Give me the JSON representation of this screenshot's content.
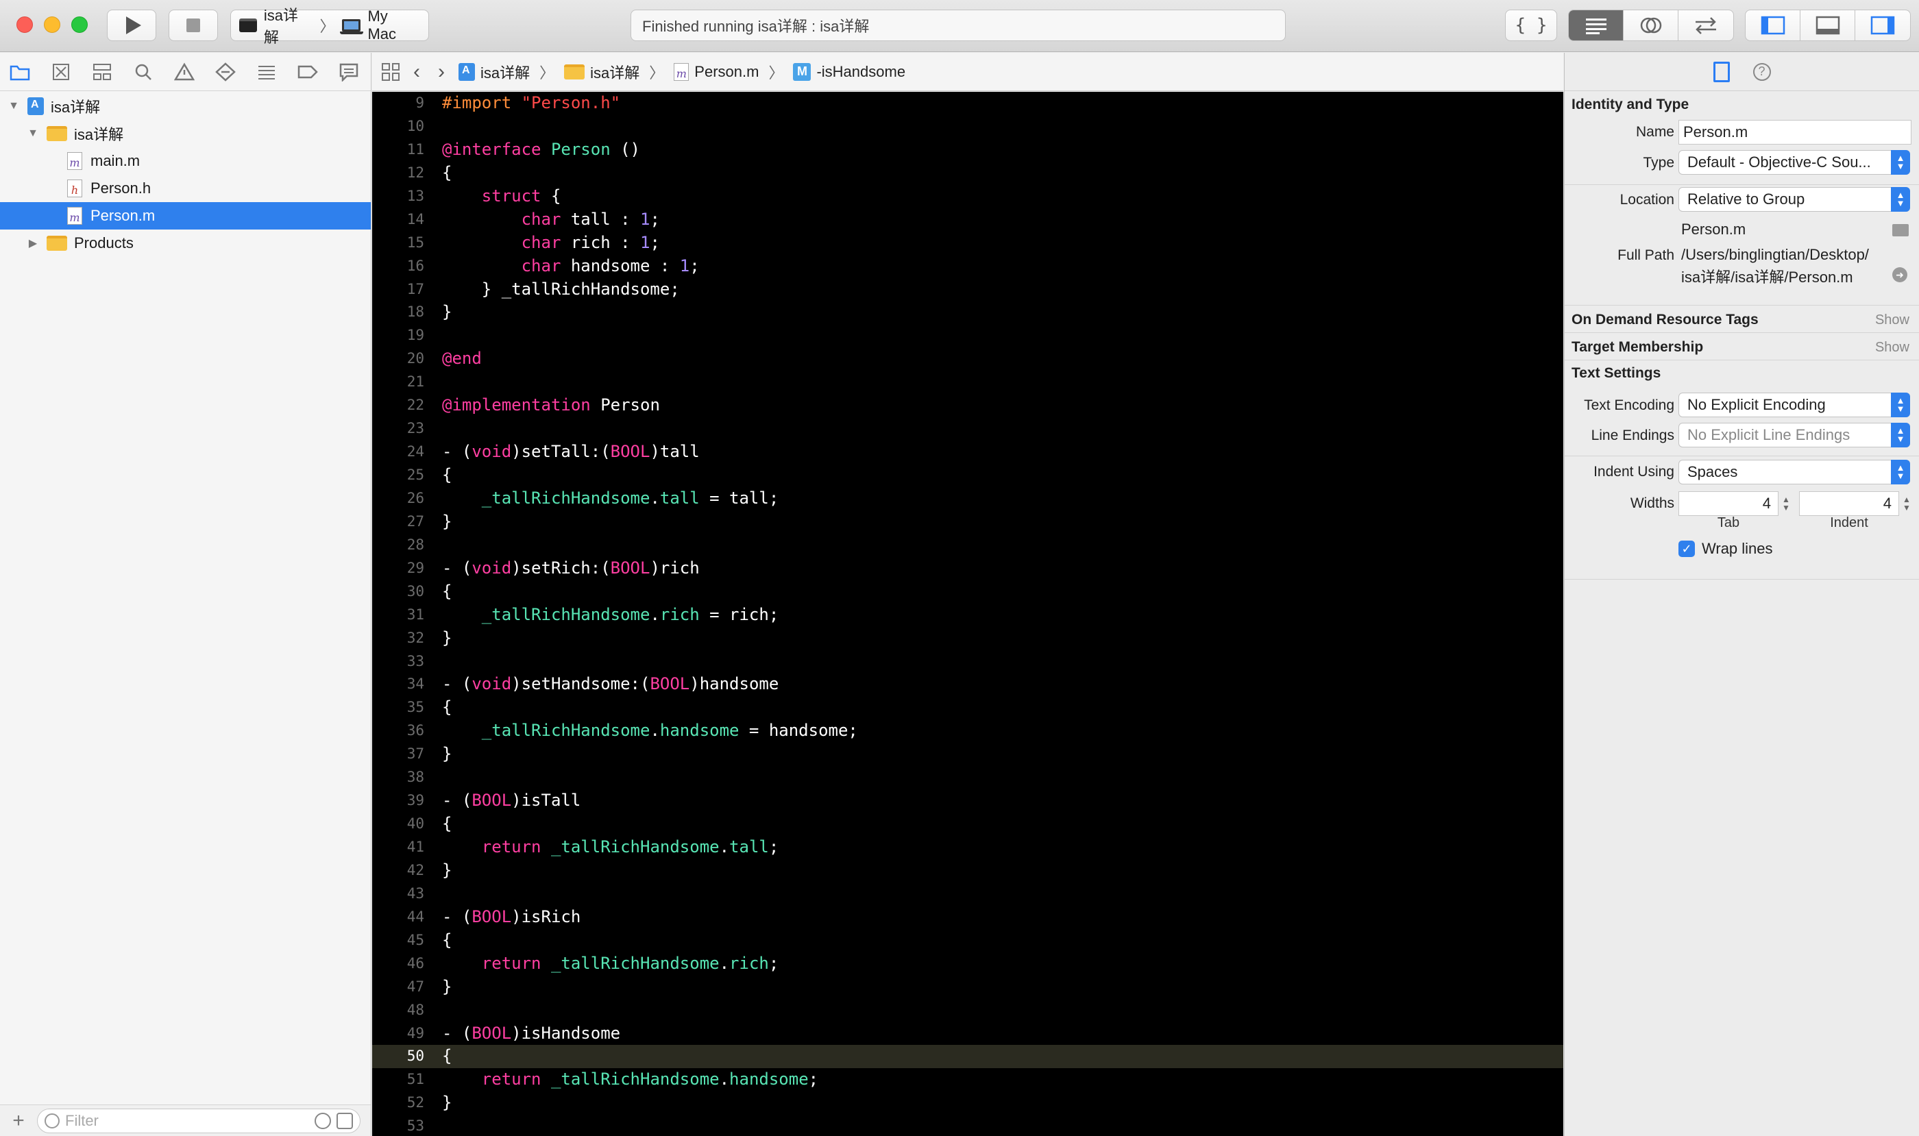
{
  "toolbar": {
    "scheme_name": "isa详解",
    "destination": "My Mac",
    "activity_status": "Finished running isa详解 : isa详解",
    "code_snippet_icon": "braces-icon",
    "editor_modes": [
      "standard-editor-icon",
      "assistant-editor-icon",
      "version-editor-icon"
    ],
    "view_toggles": [
      "navigator-toggle-icon",
      "debug-area-toggle-icon",
      "utilities-toggle-icon"
    ]
  },
  "navigator": {
    "tabs": [
      "folder-icon",
      "source-control-icon",
      "symbol-icon",
      "find-icon",
      "issue-icon",
      "test-icon",
      "debug-icon",
      "breakpoint-icon",
      "report-icon"
    ],
    "tree": [
      {
        "label": "isa详解",
        "kind": "project",
        "depth": 0,
        "expanded": true
      },
      {
        "label": "isa详解",
        "kind": "folder",
        "depth": 1,
        "expanded": true
      },
      {
        "label": "main.m",
        "kind": "m",
        "depth": 2
      },
      {
        "label": "Person.h",
        "kind": "h",
        "depth": 2
      },
      {
        "label": "Person.m",
        "kind": "m",
        "depth": 2,
        "selected": true
      },
      {
        "label": "Products",
        "kind": "folder",
        "depth": 1,
        "expanded": false
      }
    ],
    "filter_placeholder": "Filter"
  },
  "jumpbar": {
    "crumbs": [
      "isa详解",
      "isa详解",
      "Person.m",
      "-isHandsome"
    ]
  },
  "editor": {
    "current_line": 50,
    "lines": [
      {
        "n": 9,
        "html": "<span class='pre'>#import </span><span class='str'>\"Person.h\"</span>"
      },
      {
        "n": 10,
        "html": ""
      },
      {
        "n": 11,
        "html": "<span class='k'>@interface</span> <span class='cls'>Person</span> ()"
      },
      {
        "n": 12,
        "html": "{"
      },
      {
        "n": 13,
        "html": "    <span class='k'>struct</span> {"
      },
      {
        "n": 14,
        "html": "        <span class='k'>char</span> tall : <span class='num'>1</span>;"
      },
      {
        "n": 15,
        "html": "        <span class='k'>char</span> rich : <span class='num'>1</span>;"
      },
      {
        "n": 16,
        "html": "        <span class='k'>char</span> handsome : <span class='num'>1</span>;"
      },
      {
        "n": 17,
        "html": "    } _tallRichHandsome;"
      },
      {
        "n": 18,
        "html": "}"
      },
      {
        "n": 19,
        "html": ""
      },
      {
        "n": 20,
        "html": "<span class='k'>@end</span>"
      },
      {
        "n": 21,
        "html": ""
      },
      {
        "n": 22,
        "html": "<span class='k'>@implementation</span> Person"
      },
      {
        "n": 23,
        "html": ""
      },
      {
        "n": 24,
        "html": "- (<span class='k'>void</span>)setTall:(<span class='typ'>BOOL</span>)tall"
      },
      {
        "n": 25,
        "html": "{"
      },
      {
        "n": 26,
        "html": "    <span class='iv'>_tallRichHandsome</span>.<span class='iv'>tall</span> = tall;"
      },
      {
        "n": 27,
        "html": "}"
      },
      {
        "n": 28,
        "html": ""
      },
      {
        "n": 29,
        "html": "- (<span class='k'>void</span>)setRich:(<span class='typ'>BOOL</span>)rich"
      },
      {
        "n": 30,
        "html": "{"
      },
      {
        "n": 31,
        "html": "    <span class='iv'>_tallRichHandsome</span>.<span class='iv'>rich</span> = rich;"
      },
      {
        "n": 32,
        "html": "}"
      },
      {
        "n": 33,
        "html": ""
      },
      {
        "n": 34,
        "html": "- (<span class='k'>void</span>)setHandsome:(<span class='typ'>BOOL</span>)handsome"
      },
      {
        "n": 35,
        "html": "{"
      },
      {
        "n": 36,
        "html": "    <span class='iv'>_tallRichHandsome</span>.<span class='iv'>handsome</span> = handsome;"
      },
      {
        "n": 37,
        "html": "}"
      },
      {
        "n": 38,
        "html": ""
      },
      {
        "n": 39,
        "html": "- (<span class='typ'>BOOL</span>)isTall"
      },
      {
        "n": 40,
        "html": "{"
      },
      {
        "n": 41,
        "html": "    <span class='k'>return</span> <span class='iv'>_tallRichHandsome</span>.<span class='iv'>tall</span>;"
      },
      {
        "n": 42,
        "html": "}"
      },
      {
        "n": 43,
        "html": ""
      },
      {
        "n": 44,
        "html": "- (<span class='typ'>BOOL</span>)isRich"
      },
      {
        "n": 45,
        "html": "{"
      },
      {
        "n": 46,
        "html": "    <span class='k'>return</span> <span class='iv'>_tallRichHandsome</span>.<span class='iv'>rich</span>;"
      },
      {
        "n": 47,
        "html": "}"
      },
      {
        "n": 48,
        "html": ""
      },
      {
        "n": 49,
        "html": "- (<span class='typ'>BOOL</span>)isHandsome"
      },
      {
        "n": 50,
        "html": "{"
      },
      {
        "n": 51,
        "html": "    <span class='k'>return</span> <span class='iv'>_tallRichHandsome</span>.<span class='iv'>handsome</span>;"
      },
      {
        "n": 52,
        "html": "}"
      },
      {
        "n": 53,
        "html": ""
      }
    ]
  },
  "inspector": {
    "identity_title": "Identity and Type",
    "name_label": "Name",
    "name_value": "Person.m",
    "type_label": "Type",
    "type_value": "Default - Objective-C Sou...",
    "location_label": "Location",
    "location_value": "Relative to Group",
    "location_file": "Person.m",
    "full_path_label": "Full Path",
    "full_path_line1": "/Users/binglingtian/Desktop/",
    "full_path_line2": "isa详解/isa详解/Person.m",
    "odr_title": "On Demand Resource Tags",
    "odr_show": "Show",
    "target_title": "Target Membership",
    "target_show": "Show",
    "text_settings_title": "Text Settings",
    "encoding_label": "Text Encoding",
    "encoding_value": "No Explicit Encoding",
    "line_endings_label": "Line Endings",
    "line_endings_value": "No Explicit Line Endings",
    "indent_using_label": "Indent Using",
    "indent_using_value": "Spaces",
    "widths_label": "Widths",
    "tab_width": "4",
    "indent_width": "4",
    "tab_label": "Tab",
    "indent_label": "Indent",
    "wrap_lines_label": "Wrap lines",
    "wrap_lines_checked": true
  }
}
